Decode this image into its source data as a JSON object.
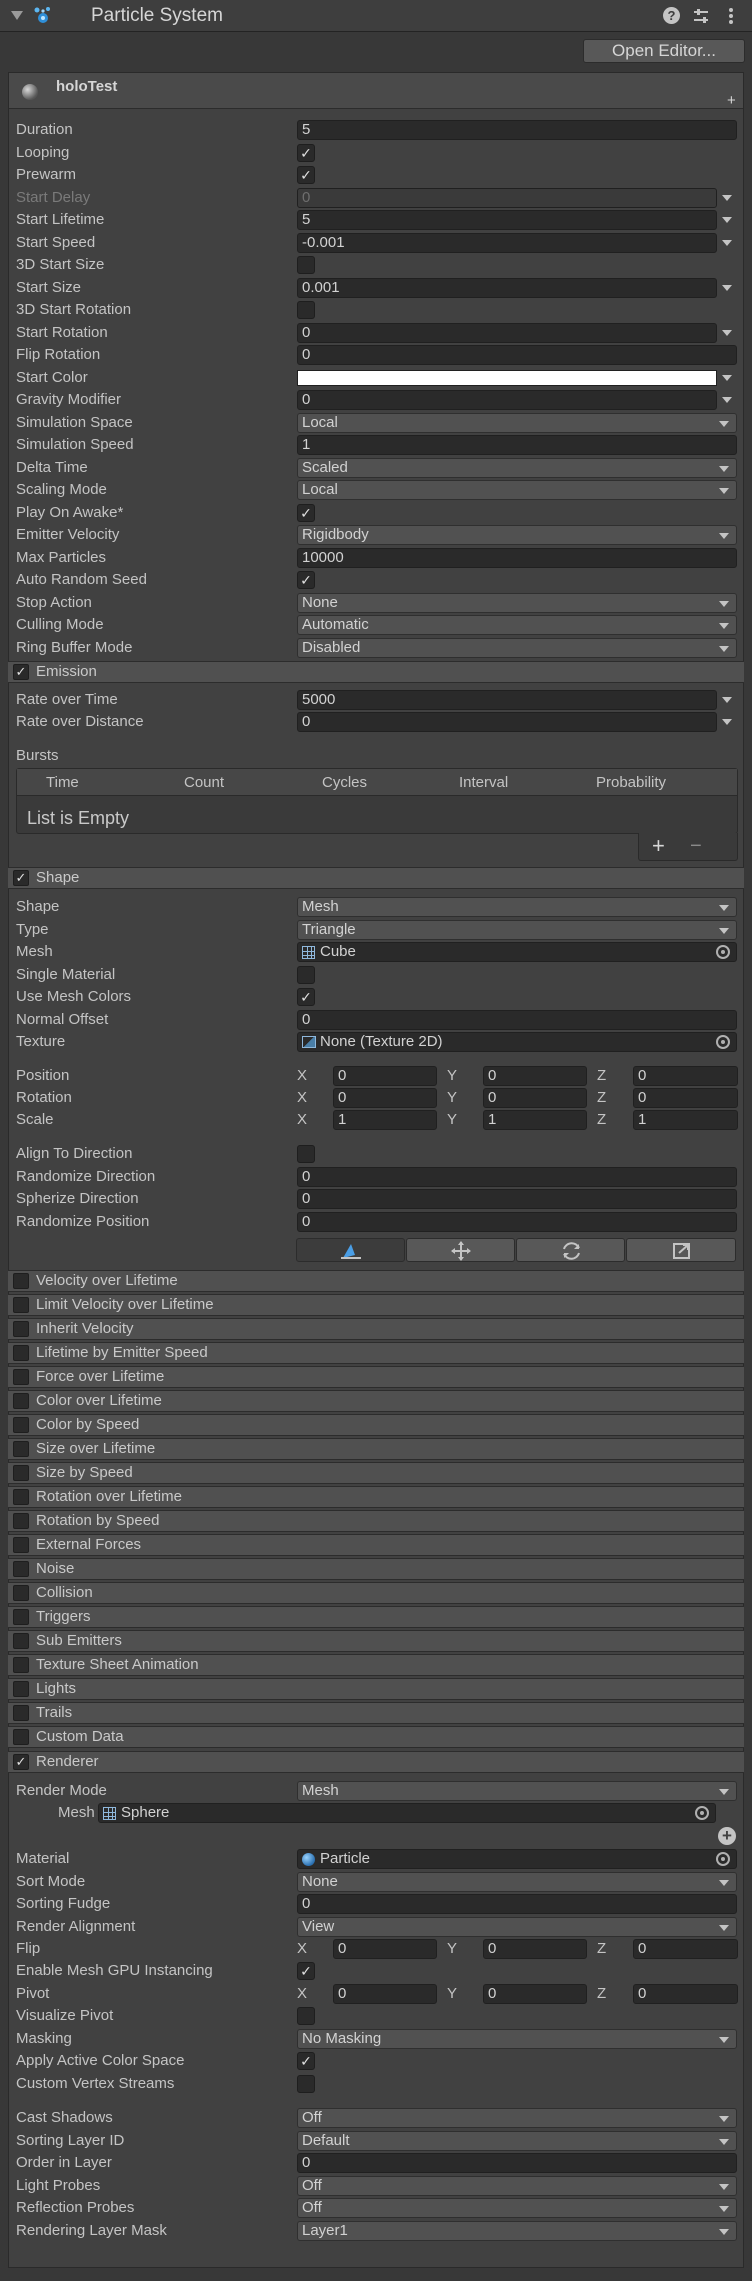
{
  "header": {
    "title": "Particle System",
    "open_editor": "Open Editor..."
  },
  "system": {
    "name": "holoTest"
  },
  "main_fields": [
    {
      "label": "Duration",
      "type": "field",
      "value": "5"
    },
    {
      "label": "Looping",
      "type": "check",
      "checked": true
    },
    {
      "label": "Prewarm",
      "type": "check",
      "checked": true
    },
    {
      "label": "Start Delay",
      "type": "field",
      "value": "0",
      "disabled": true,
      "curve": true
    },
    {
      "label": "Start Lifetime",
      "type": "field",
      "value": "5",
      "curve": true
    },
    {
      "label": "Start Speed",
      "type": "field",
      "value": "-0.001",
      "curve": true
    },
    {
      "label": "3D Start Size",
      "type": "check",
      "checked": false
    },
    {
      "label": "Start Size",
      "type": "field",
      "value": "0.001",
      "curve": true
    },
    {
      "label": "3D Start Rotation",
      "type": "check",
      "checked": false
    },
    {
      "label": "Start Rotation",
      "type": "field",
      "value": "0",
      "curve": true
    },
    {
      "label": "Flip Rotation",
      "type": "field",
      "value": "0"
    },
    {
      "label": "Start Color",
      "type": "color",
      "value": "#ffffff",
      "curve": true
    },
    {
      "label": "Gravity Modifier",
      "type": "field",
      "value": "0",
      "curve": true
    },
    {
      "label": "Simulation Space",
      "type": "dropdown",
      "value": "Local"
    },
    {
      "label": "Simulation Speed",
      "type": "field",
      "value": "1"
    },
    {
      "label": "Delta Time",
      "type": "dropdown",
      "value": "Scaled"
    },
    {
      "label": "Scaling Mode",
      "type": "dropdown",
      "value": "Local"
    },
    {
      "label": "Play On Awake*",
      "type": "check",
      "checked": true
    },
    {
      "label": "Emitter Velocity",
      "type": "dropdown",
      "value": "Rigidbody"
    },
    {
      "label": "Max Particles",
      "type": "field",
      "value": "10000"
    },
    {
      "label": "Auto Random Seed",
      "type": "check",
      "checked": true
    },
    {
      "label": "Stop Action",
      "type": "dropdown",
      "value": "None"
    },
    {
      "label": "Culling Mode",
      "type": "dropdown",
      "value": "Automatic"
    },
    {
      "label": "Ring Buffer Mode",
      "type": "dropdown",
      "value": "Disabled"
    }
  ],
  "emission": {
    "title": "Emission",
    "rate_over_time_label": "Rate over Time",
    "rate_over_time": "5000",
    "rate_over_distance_label": "Rate over Distance",
    "rate_over_distance": "0",
    "bursts_label": "Bursts",
    "burst_columns": [
      "Time",
      "Count",
      "Cycles",
      "Interval",
      "Probability"
    ],
    "empty_text": "List is Empty"
  },
  "shape": {
    "title": "Shape",
    "fields": [
      {
        "label": "Shape",
        "type": "dropdown",
        "value": "Mesh"
      },
      {
        "label": "Type",
        "type": "dropdown",
        "value": "Triangle"
      },
      {
        "label": "Mesh",
        "type": "object",
        "value": "Cube",
        "icon": "mesh-grid-icon"
      },
      {
        "label": "Single Material",
        "type": "check",
        "checked": false
      },
      {
        "label": "Use Mesh Colors",
        "type": "check",
        "checked": true
      },
      {
        "label": "Normal Offset",
        "type": "field",
        "value": "0"
      },
      {
        "label": "Texture",
        "type": "object",
        "value": "None (Texture 2D)",
        "icon": "texture-icon"
      }
    ],
    "position": {
      "label": "Position",
      "x": "0",
      "y": "0",
      "z": "0"
    },
    "rotation": {
      "label": "Rotation",
      "x": "0",
      "y": "0",
      "z": "0"
    },
    "scale": {
      "label": "Scale",
      "x": "1",
      "y": "1",
      "z": "1"
    },
    "fields2": [
      {
        "label": "Align To Direction",
        "type": "check",
        "checked": false
      },
      {
        "label": "Randomize Direction",
        "type": "field",
        "value": "0"
      },
      {
        "label": "Spherize Direction",
        "type": "field",
        "value": "0"
      },
      {
        "label": "Randomize Position",
        "type": "field",
        "value": "0"
      }
    ]
  },
  "modules": [
    "Velocity over Lifetime",
    "Limit Velocity over Lifetime",
    "Inherit Velocity",
    "Lifetime by Emitter Speed",
    "Force over Lifetime",
    "Color over Lifetime",
    "Color by Speed",
    "Size over Lifetime",
    "Size by Speed",
    "Rotation over Lifetime",
    "Rotation by Speed",
    "External Forces",
    "Noise",
    "Collision",
    "Triggers",
    "Sub Emitters",
    "Texture Sheet Animation",
    "Lights",
    "Trails",
    "Custom Data"
  ],
  "renderer": {
    "title": "Renderer",
    "render_mode_label": "Render Mode",
    "render_mode": "Mesh",
    "mesh_label": "Mesh",
    "mesh": "Sphere",
    "fields": [
      {
        "label": "Material",
        "type": "object",
        "value": "Particle",
        "icon": "material-sphere-icon"
      },
      {
        "label": "Sort Mode",
        "type": "dropdown",
        "value": "None"
      },
      {
        "label": "Sorting Fudge",
        "type": "field",
        "value": "0"
      },
      {
        "label": "Render Alignment",
        "type": "dropdown",
        "value": "View"
      }
    ],
    "flip": {
      "label": "Flip",
      "x": "0",
      "y": "0",
      "z": "0"
    },
    "gpu_instancing_label": "Enable Mesh GPU Instancing",
    "pivot": {
      "label": "Pivot",
      "x": "0",
      "y": "0",
      "z": "0"
    },
    "fields2": [
      {
        "label": "Visualize Pivot",
        "type": "check",
        "checked": false
      },
      {
        "label": "Masking",
        "type": "dropdown",
        "value": "No Masking"
      },
      {
        "label": "Apply Active Color Space",
        "type": "check",
        "checked": true
      },
      {
        "label": "Custom Vertex Streams",
        "type": "check",
        "checked": false
      }
    ],
    "fields3": [
      {
        "label": "Cast Shadows",
        "type": "dropdown",
        "value": "Off"
      },
      {
        "label": "Sorting Layer ID",
        "type": "dropdown",
        "value": "Default"
      },
      {
        "label": "Order in Layer",
        "type": "field",
        "value": "0"
      },
      {
        "label": "Light Probes",
        "type": "dropdown",
        "value": "Off"
      },
      {
        "label": "Reflection Probes",
        "type": "dropdown",
        "value": "Off"
      },
      {
        "label": "Rendering Layer Mask",
        "type": "dropdown",
        "value": "Layer1"
      }
    ]
  },
  "axis_labels": {
    "x": "X",
    "y": "Y",
    "z": "Z"
  }
}
